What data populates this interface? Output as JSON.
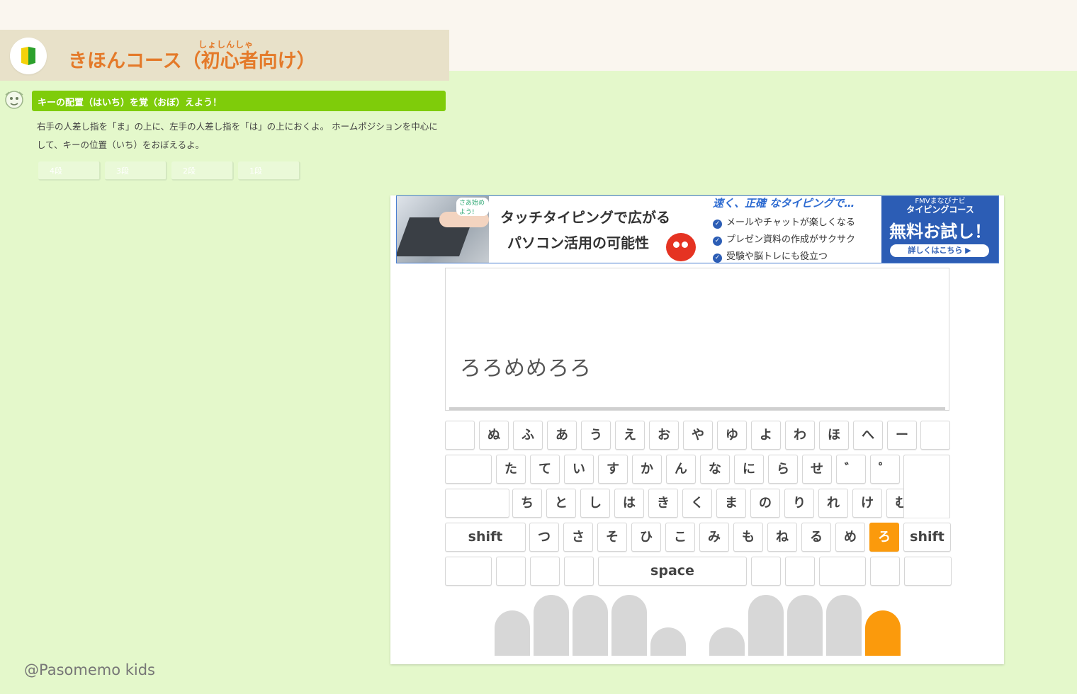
{
  "course": {
    "title": "きほんコース（初心者向け）",
    "ruby": "しょしんしゃ",
    "lesson_title": "キーの配置（はいち）を覚（おぼ）えよう！",
    "lesson_desc": "右手の人差し指を「ま」の上に、左手の人差し指を「は」の上におくよ。 ホームポジションを中心にして、キーの位置（いち）をおぼえるよ。",
    "rows": [
      "4段",
      "3段",
      "2段",
      "1段"
    ]
  },
  "ad": {
    "bubble": "さあ始めよう!",
    "headline1": "タッチタイピングで広がる",
    "headline2": "パソコン活用の可能性",
    "top": "速く、正確 なタイピングで…",
    "bullets": [
      "メールやチャットが楽しくなる",
      "プレゼン資料の作成がサクサク",
      "受験や脳トレにも役立つ"
    ],
    "cta_small": "FMVまなびナビ",
    "cta_course": "タイピングコース",
    "cta_main": "無料お試し！",
    "cta_button": "詳しくはこちら ▶"
  },
  "typing": {
    "text": "ろろめめろろ"
  },
  "keyboard": {
    "rows": [
      [
        "",
        "ぬ",
        "ふ",
        "あ",
        "う",
        "え",
        "お",
        "や",
        "ゆ",
        "よ",
        "わ",
        "ほ",
        "へ",
        "ー",
        ""
      ],
      [
        "",
        "た",
        "て",
        "い",
        "す",
        "か",
        "ん",
        "な",
        "に",
        "ら",
        "せ",
        "゛",
        "゜",
        ""
      ],
      [
        "",
        "ち",
        "と",
        "し",
        "は",
        "き",
        "く",
        "ま",
        "の",
        "り",
        "れ",
        "け",
        "む",
        ""
      ],
      [
        "shift",
        "つ",
        "さ",
        "そ",
        "ひ",
        "こ",
        "み",
        "も",
        "ね",
        "る",
        "め",
        "ろ",
        "shift"
      ],
      [
        "",
        "",
        "",
        "",
        "space",
        "",
        "",
        "",
        "",
        ""
      ]
    ],
    "active_key": "ろ",
    "active_color": "#fb9a0c"
  },
  "credit": "@Pasomemo kids"
}
